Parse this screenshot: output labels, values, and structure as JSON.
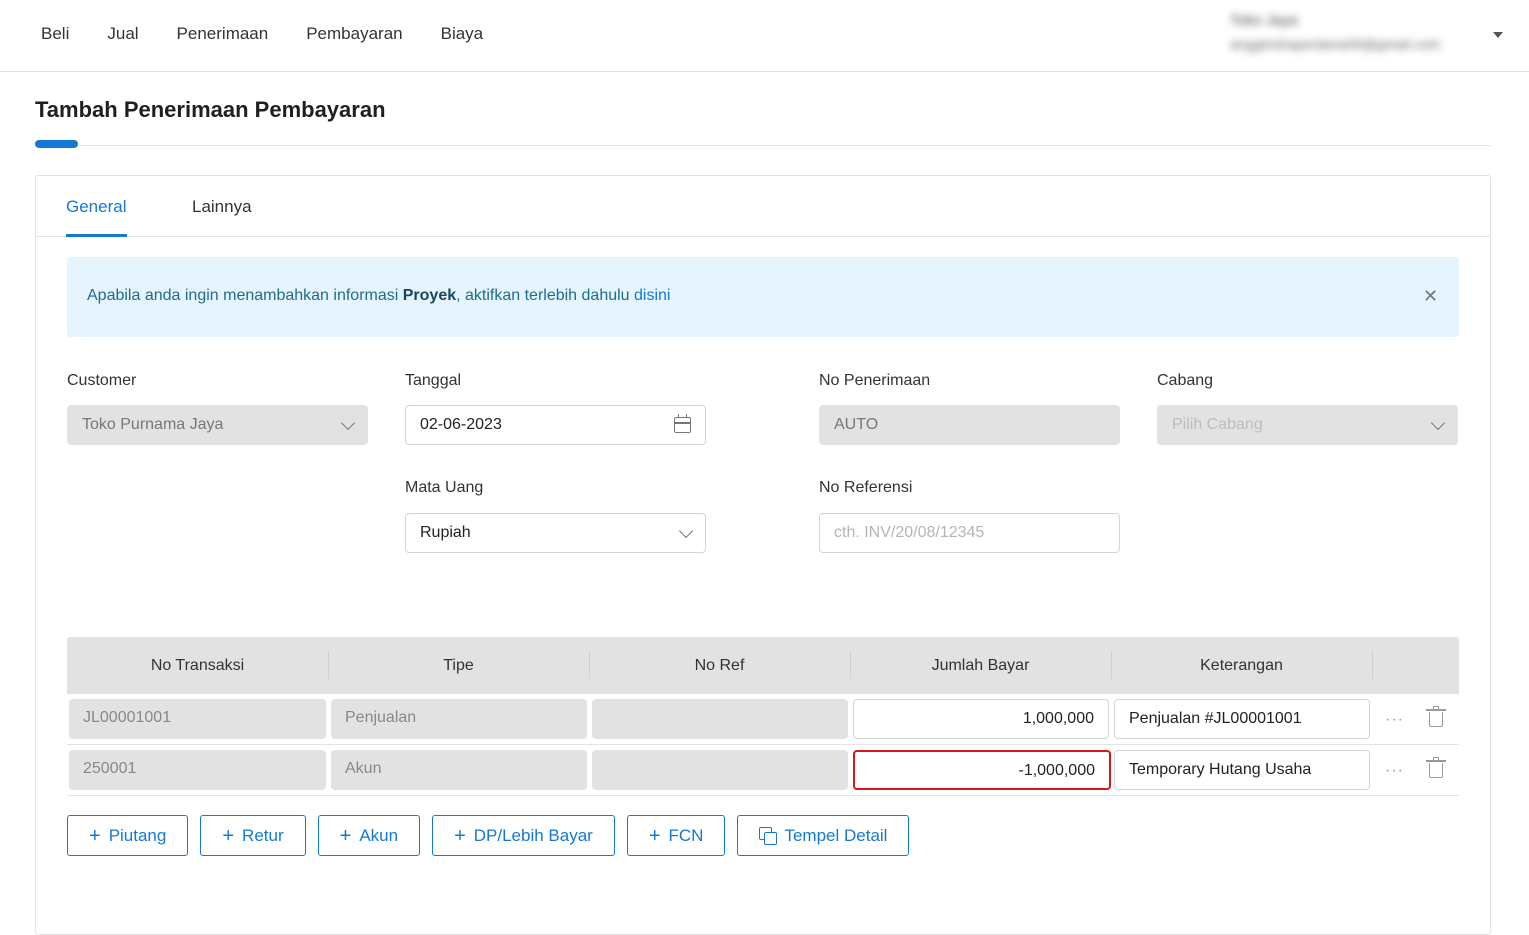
{
  "topnav": [
    "Beli",
    "Jual",
    "Penerimaan",
    "Pembayaran",
    "Biaya"
  ],
  "user": {
    "name": "Toko Jaya",
    "email": "anggiindraperdana06@gmail.com"
  },
  "page_title": "Tambah Penerimaan Pembayaran",
  "tabs": [
    "General",
    "Lainnya"
  ],
  "alert": {
    "prefix": "Apabila anda ingin menambahkan informasi ",
    "bold": "Proyek",
    "middle": ", aktifkan terlebih dahulu ",
    "link": "disini",
    "close": "✕"
  },
  "form": {
    "customer_label": "Customer",
    "customer_value": "Toko Purnama Jaya",
    "tanggal_label": "Tanggal",
    "tanggal_value": "02-06-2023",
    "no_penerimaan_label": "No Penerimaan",
    "no_penerimaan_value": "AUTO",
    "cabang_label": "Cabang",
    "cabang_placeholder": "Pilih Cabang",
    "mata_uang_label": "Mata Uang",
    "mata_uang_value": "Rupiah",
    "no_referensi_label": "No Referensi",
    "no_referensi_placeholder": "cth. INV/20/08/12345"
  },
  "table": {
    "headers": [
      "No Transaksi",
      "Tipe",
      "No Ref",
      "Jumlah Bayar",
      "Keterangan"
    ],
    "rows": [
      {
        "no_transaksi": "JL00001001",
        "tipe": "Penjualan",
        "no_ref": "",
        "jumlah_bayar": "1,000,000",
        "keterangan": "Penjualan #JL00001001"
      },
      {
        "no_transaksi": "250001",
        "tipe": "Akun",
        "no_ref": "",
        "jumlah_bayar": "-1,000,000",
        "keterangan": "Temporary Hutang Usaha"
      }
    ],
    "row_menu": "···"
  },
  "buttons": {
    "piutang": "Piutang",
    "retur": "Retur",
    "akun": "Akun",
    "dp": "DP/Lebih Bayar",
    "fcn": "FCN",
    "tempel": "Tempel Detail",
    "plus": "+"
  },
  "colors": {
    "accent": "#1479d4",
    "error": "#d9141b",
    "alert_bg": "#e6f5fd"
  }
}
